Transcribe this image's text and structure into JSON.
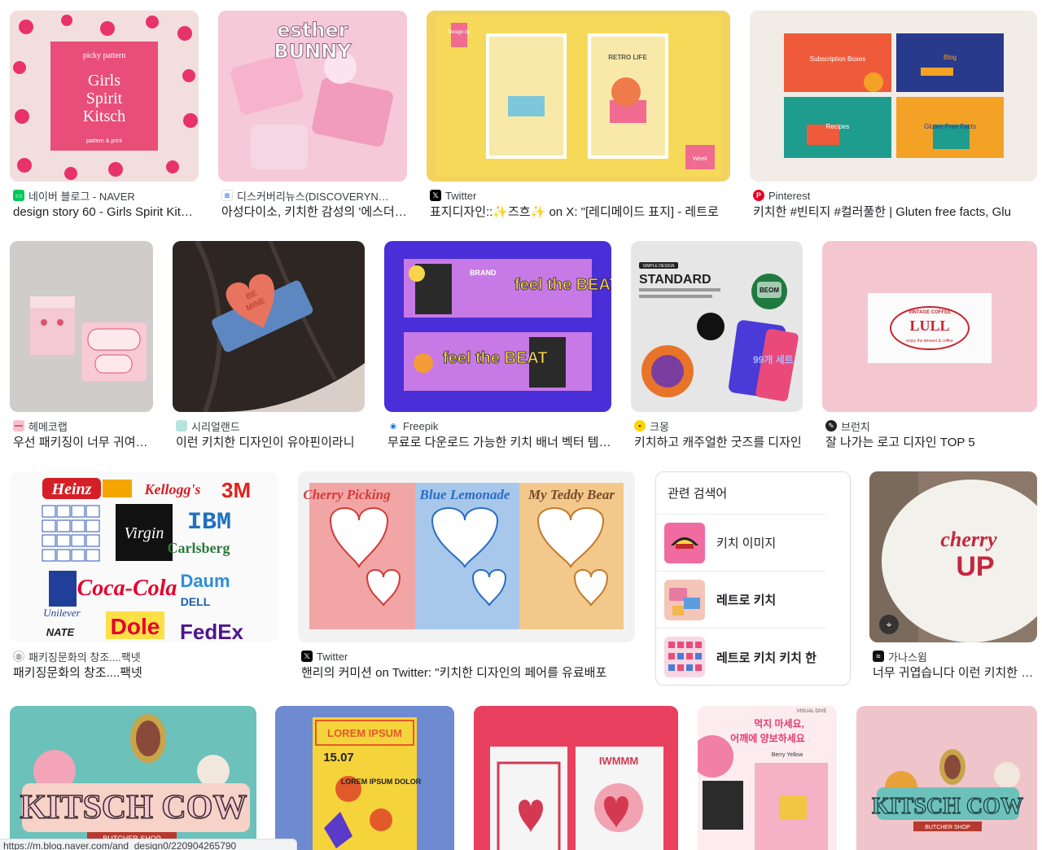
{
  "colors": {
    "text_primary": "#202124",
    "text_secondary": "#3c4043",
    "border": "#dadce0"
  },
  "results": [
    {
      "source": "네이버 블로그 - NAVER",
      "title": "design story 60 - Girls Spirit Kitsch",
      "favicon": "naver-blog-icon",
      "thumb_text": [
        "picky pattern",
        "Girls",
        "Spirit",
        "Kitsch",
        "pattern & print"
      ]
    },
    {
      "source": "디스커버리뉴스(DISCOVERYNEWS)",
      "title": "아성다이소, 키치한 감성의 '에스더버니'",
      "favicon": "discovery-news-icon",
      "thumb_text": [
        "esther",
        "BUNNY"
      ]
    },
    {
      "source": "Twitter",
      "title": "표지디자인::✨즈흐✨ on X: \"[레디메이드 표지] - 레트로",
      "favicon": "x-icon",
      "thumb_text": [
        "Design by",
        "RETRO LIFE",
        "Week"
      ]
    },
    {
      "source": "Pinterest",
      "title": "키치한 #빈티지 #컬러풀한 | Gluten free facts, Glu",
      "favicon": "pinterest-icon",
      "thumb_text": [
        "Subscription Boxes",
        "Blog",
        "Recipes",
        "Gluten Free Facts"
      ]
    },
    {
      "source": "헤메코랩",
      "title": "우선 패키징이 너무 귀여워요",
      "favicon": "hemeco-icon"
    },
    {
      "source": "시리얼랜드",
      "title": "이런 키치한 디자인이 유아핀이라니",
      "favicon": "cerealland-icon",
      "thumb_text": [
        "BE",
        "MINE"
      ]
    },
    {
      "source": "Freepik",
      "title": "무료로 다운로드 가능한 키치 배너 벡터 템플릿",
      "favicon": "freepik-icon",
      "thumb_text": [
        "BRAND",
        "feel the BEAT"
      ]
    },
    {
      "source": "크몽",
      "title": "키치하고 캐주얼한 굿즈를 디자인",
      "favicon": "kmong-icon",
      "thumb_text": [
        "SIMPLE DESIGN",
        "STANDARD",
        "BEOM",
        "99개 세트"
      ]
    },
    {
      "source": "브런치",
      "title": "잘 나가는 로고 디자인 TOP 5",
      "favicon": "brunch-icon",
      "thumb_text": [
        "VINTAGE COFFEE",
        "LULL",
        "enjoy the dessert & coffee"
      ]
    },
    {
      "source": "패키징문화의 창조....팩넷",
      "title": "패키징문화의 창조....팩넷",
      "favicon": "globe-icon",
      "thumb_text": [
        "Heinz",
        "Kellogg's",
        "3M",
        "Virgin",
        "IBM",
        "Carlsberg",
        "Unilever",
        "Coca-Cola",
        "Daum",
        "DELL",
        "NATE",
        "Dole",
        "FedEx"
      ]
    },
    {
      "source": "Twitter",
      "title": "핸리의 커미션 on Twitter: \"키치한 디자인의 페어를 유료배포",
      "favicon": "x-icon",
      "thumb_text": [
        "Cherry Picking",
        "Blue Lemonade",
        "My Teddy Bear"
      ]
    },
    {
      "source": "가나스윔",
      "title": "너무 귀엽습니다 이런 키치한 디자인",
      "favicon": "ganaswim-icon",
      "thumb_text": [
        "cherry",
        "UP"
      ]
    },
    {
      "title": "",
      "source": "",
      "thumb_text": [
        "KITSCH COW",
        "BUTCHER SHOP"
      ]
    },
    {
      "title": "",
      "source": "",
      "thumb_text": [
        "LOREM IPSUM",
        "15.07",
        "LOREM IPSUM DOLOR"
      ]
    },
    {
      "title": "",
      "source": "",
      "thumb_text": [
        "IWMMM"
      ]
    },
    {
      "title": "",
      "source": "",
      "thumb_text": [
        "먹지 마세요,",
        "어깨에 양보하세요",
        "VISUAL DIVE",
        "Berry Yellow"
      ]
    },
    {
      "title": "",
      "source": "",
      "thumb_text": [
        "KITSCH COW",
        "BUTCHER SHOP"
      ]
    }
  ],
  "related": {
    "heading": "관련 검색어",
    "items": [
      {
        "label": "키치 이미지"
      },
      {
        "label": "레트로 키치"
      },
      {
        "label": "레트로 키치 키치 한"
      }
    ]
  },
  "status_bar": {
    "url": "https://m.blog.naver.com/and_design0/220904265790"
  }
}
